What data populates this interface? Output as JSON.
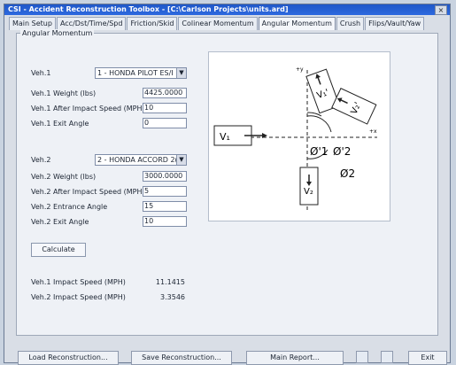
{
  "app": {
    "title": "CSI - Accident Reconstruction Toolbox - [C:\\Carlson Projects\\units.ard]",
    "close_glyph": "×"
  },
  "tabs": [
    {
      "label": "Main Setup"
    },
    {
      "label": "Acc/Dst/Time/Spd"
    },
    {
      "label": "Friction/Skid"
    },
    {
      "label": "Colinear Momentum"
    },
    {
      "label": "Angular Momentum",
      "active": true
    },
    {
      "label": "Crush"
    },
    {
      "label": "Flips/Vault/Yaw"
    }
  ],
  "panel": {
    "title": "Angular Momentum",
    "veh1": {
      "label": "Veh.1",
      "selected": "1 - HONDA PILOT ES/I",
      "weight_label": "Veh.1 Weight (lbs)",
      "weight_value": "4425.0000",
      "after_speed_label": "Veh.1 After Impact Speed (MPH)",
      "after_speed_value": "10",
      "exit_angle_label": "Veh.1 Exit Angle",
      "exit_angle_value": "0"
    },
    "veh2": {
      "label": "Veh.2",
      "selected": "2 - HONDA ACCORD 2(",
      "weight_label": "Veh.2 Weight (lbs)",
      "weight_value": "3000.0000",
      "after_speed_label": "Veh.2 After Impact Speed (MPH)",
      "after_speed_value": "5",
      "entrance_angle_label": "Veh.2 Entrance Angle",
      "entrance_angle_value": "15",
      "exit_angle_label": "Veh.2 Exit Angle",
      "exit_angle_value": "10"
    },
    "calculate_label": "Calculate",
    "results": {
      "veh1_label": "Veh.1 Impact Speed (MPH)",
      "veh1_value": "11.1415",
      "veh2_label": "Veh.2 Impact Speed (MPH)",
      "veh2_value": "3.3546"
    },
    "diagram": {
      "y_axis_label": "+y",
      "x_axis_label": "+x",
      "v1_label": "V₁",
      "v1prime_label": "V₁'",
      "v2prime_label": "V₂'",
      "v2_label": "V₂",
      "phi1_label": "Ø'1",
      "phi2p_label": "Ø'2",
      "phi2_label": "Ø2"
    }
  },
  "footer": {
    "load_label": "Load Reconstruction...",
    "save_label": "Save Reconstruction...",
    "report_label": "Main Report...",
    "exit_label": "Exit"
  }
}
